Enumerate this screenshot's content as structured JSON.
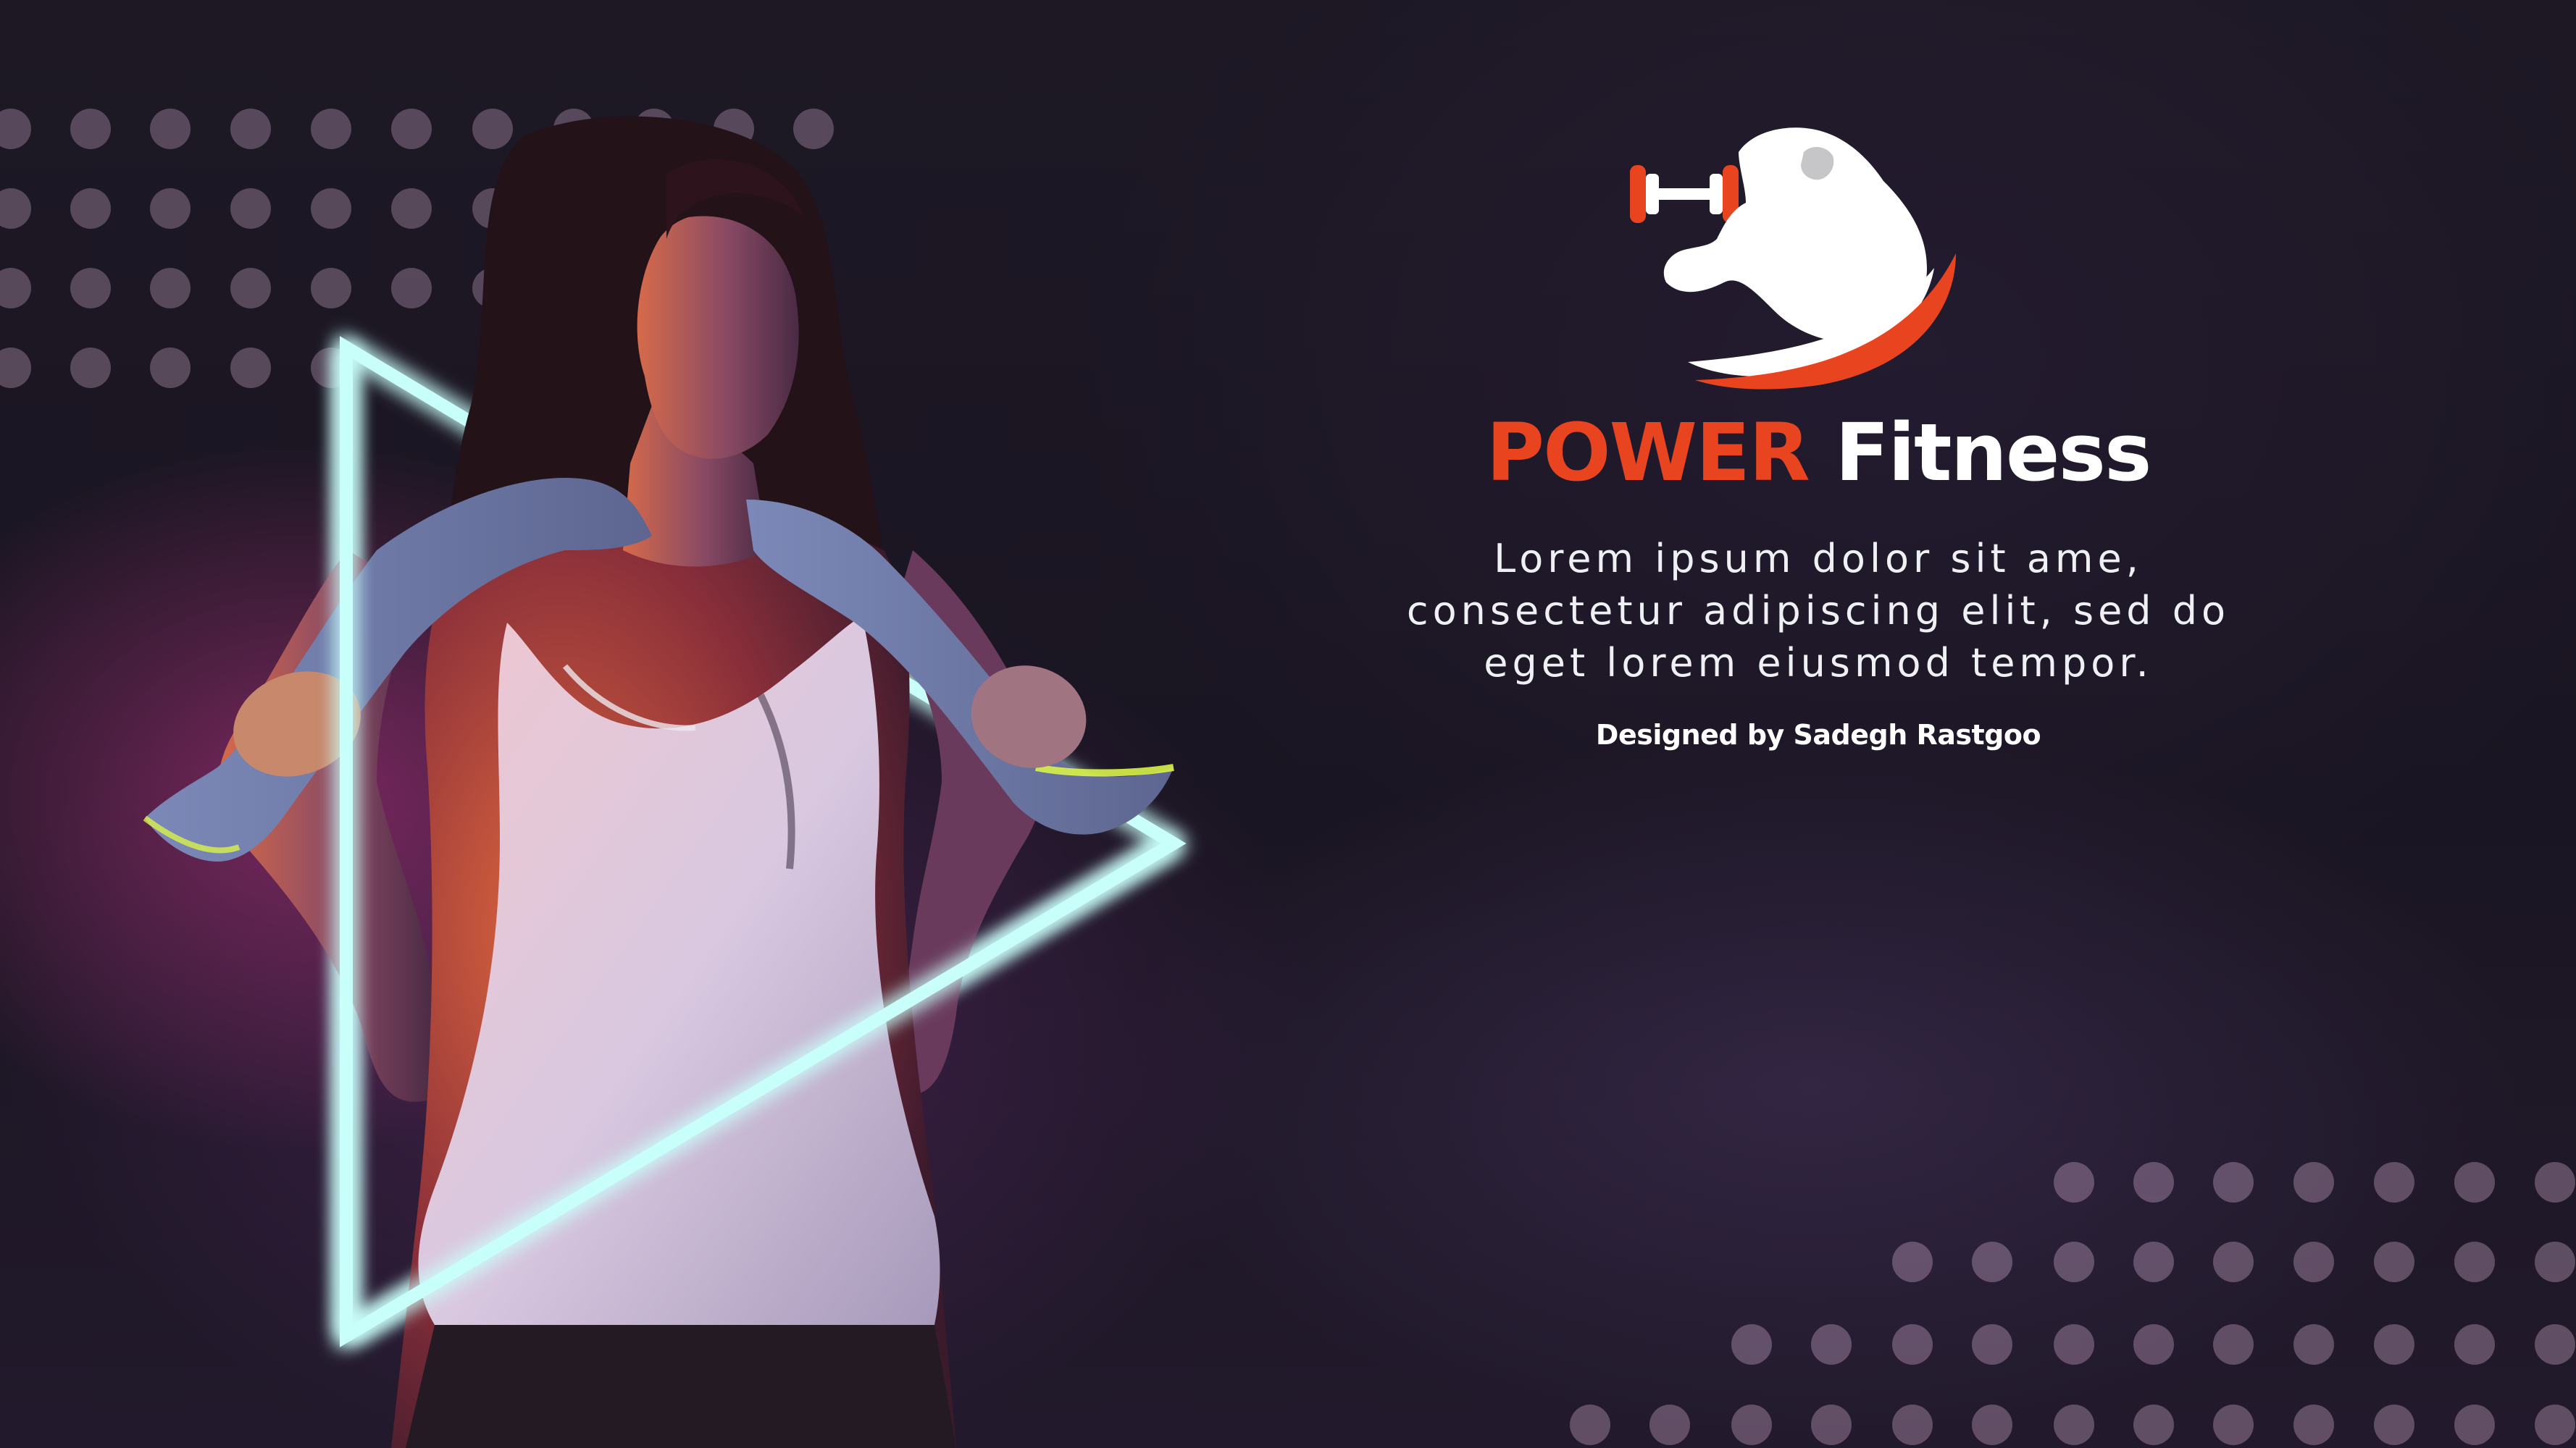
{
  "brand": {
    "title_accent": "POWER",
    "title_main": "Fitness",
    "description_lines": [
      "Lorem ipsum dolor sit ame,",
      "consectetur adipiscing elit, sed do",
      "eget lorem eiusmod tempor."
    ],
    "credit": "Designed by Sadegh Rastgoo"
  },
  "colors": {
    "accent": "#e8441f",
    "neon": "#9ff8f2",
    "background": "#16131c",
    "dots": "#f1c7ea"
  },
  "icons": {
    "logo": "bodybuilder-dumbbell-logo"
  }
}
